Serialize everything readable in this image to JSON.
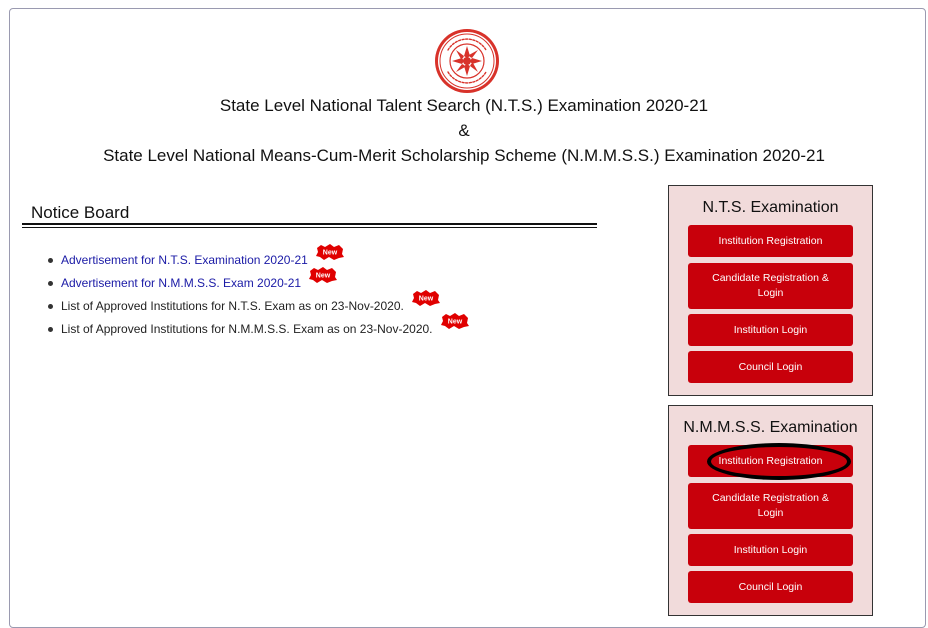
{
  "header": {
    "title_line_1": "State Level National Talent Search (N.T.S.) Examination 2020-21",
    "title_ampersand": "&",
    "title_line_2": "State Level National Means-Cum-Merit Scholarship Scheme (N.M.M.S.S.) Examination 2020-21",
    "logo_icon": "council-seal-logo"
  },
  "notice_board": {
    "heading": "Notice Board",
    "items": [
      {
        "label": "Advertisement for N.T.S. Examination 2020-21",
        "is_link": true,
        "badge": "New"
      },
      {
        "label": "Advertisement for N.M.M.S.S. Exam 2020-21",
        "is_link": true,
        "badge": "New"
      },
      {
        "label": "List of Approved Institutions for N.T.S. Exam as on 23-Nov-2020.",
        "is_link": false,
        "badge": "New"
      },
      {
        "label": "List of Approved Institutions for N.M.M.S.S. Exam as on 23-Nov-2020.",
        "is_link": false,
        "badge": "New"
      }
    ]
  },
  "nts_panel": {
    "title": "N.T.S. Examination",
    "buttons": [
      "Institution Registration",
      "Candidate Registration & Login",
      "Institution Login",
      "Council Login"
    ]
  },
  "nmmss_panel": {
    "title": "N.M.M.S.S. Examination",
    "buttons": [
      "Institution Registration",
      "Candidate Registration & Login",
      "Institution Login",
      "Council Login"
    ]
  },
  "colors": {
    "button_red": "#c8000b",
    "panel_bg": "#f1dbdb",
    "link_blue": "#1a1aa6",
    "badge_red": "#e00000",
    "highlight_ring": "#000000"
  }
}
